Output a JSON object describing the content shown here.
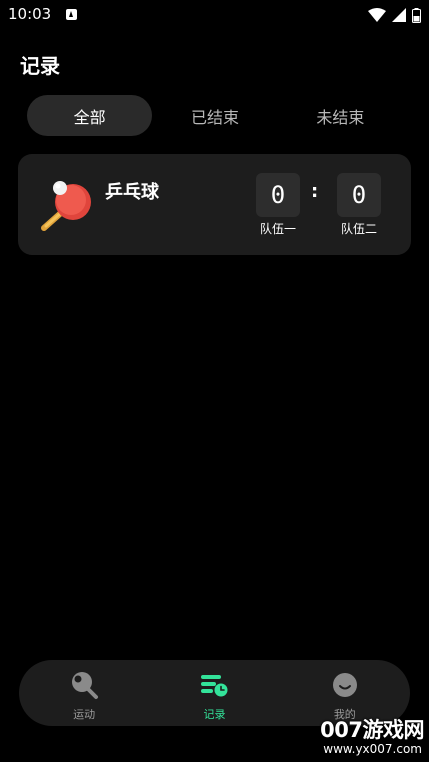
{
  "status_bar": {
    "time": "10:03"
  },
  "page": {
    "title": "记录"
  },
  "tabs": [
    {
      "label": "全部",
      "active": true
    },
    {
      "label": "已结束",
      "active": false
    },
    {
      "label": "未结束",
      "active": false
    }
  ],
  "records": [
    {
      "sport": "乒乓球",
      "icon": "ping-pong-paddle-icon",
      "team_a": {
        "name": "队伍一",
        "score": "0"
      },
      "team_b": {
        "name": "队伍二",
        "score": "0"
      },
      "separator": ":"
    }
  ],
  "bottom_nav": [
    {
      "label": "运动",
      "icon": "ping-pong-icon",
      "active": false
    },
    {
      "label": "记录",
      "icon": "record-list-icon",
      "active": true
    },
    {
      "label": "我的",
      "icon": "smiley-icon",
      "active": false
    }
  ],
  "watermark": {
    "line1": "007游戏网",
    "line2": "www.yx007.com"
  },
  "colors": {
    "accent": "#33e39a",
    "card_bg": "#1d1d1d",
    "background": "#000000"
  }
}
